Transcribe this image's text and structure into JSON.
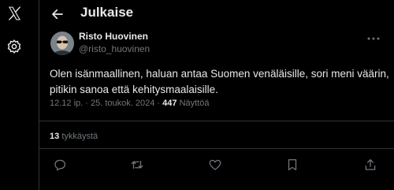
{
  "header": {
    "title": "Julkaise"
  },
  "author": {
    "name": "Risto Huovinen",
    "handle": "@risto_huovinen"
  },
  "tweet": {
    "text_line1": "Olen isänmaallinen, haluan antaa Suomen venäläisille, sori meni väärin,",
    "text_line2": "pitikin sanoa että kehitysmaalaisille.",
    "time": "12.12 ip.",
    "date": "25. toukok. 2024",
    "separator": "·",
    "views_count": "447",
    "views_label": "Näyttöä"
  },
  "likes": {
    "count": "13",
    "label": "tykkäystä"
  },
  "icons": {
    "logo": "x-logo-icon",
    "settings": "gear-icon",
    "back": "back-arrow-icon",
    "more": "more-icon",
    "reply": "reply-icon",
    "retweet": "retweet-icon",
    "like": "heart-icon",
    "bookmark": "bookmark-icon",
    "share": "share-icon"
  },
  "colors": {
    "background": "#000000",
    "text": "#e7e9ea",
    "muted": "#71767b",
    "divider": "#2f3336"
  }
}
